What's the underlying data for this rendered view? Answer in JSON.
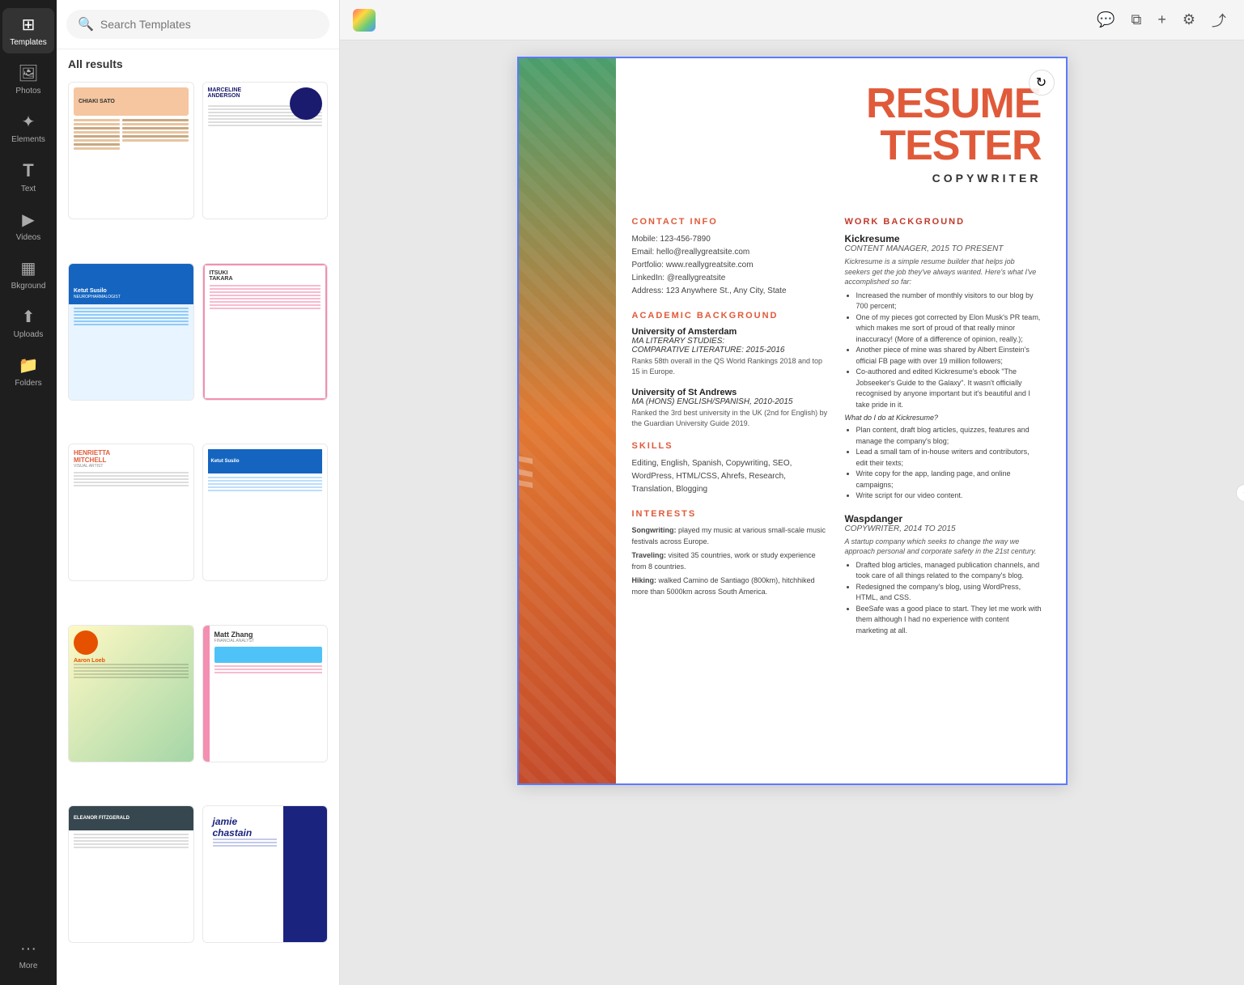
{
  "sidebar": {
    "title": "Templates",
    "items": [
      {
        "id": "templates",
        "label": "Templates",
        "icon": "⊞",
        "active": true
      },
      {
        "id": "photos",
        "label": "Photos",
        "icon": "🖼"
      },
      {
        "id": "elements",
        "label": "Elements",
        "icon": "✦"
      },
      {
        "id": "text",
        "label": "Text",
        "icon": "T"
      },
      {
        "id": "videos",
        "label": "Videos",
        "icon": "▶"
      },
      {
        "id": "background",
        "label": "Bkground",
        "icon": "▦"
      },
      {
        "id": "uploads",
        "label": "Uploads",
        "icon": "↑"
      },
      {
        "id": "folders",
        "label": "Folders",
        "icon": "🗁"
      },
      {
        "id": "more",
        "label": "More",
        "icon": "···"
      }
    ]
  },
  "search": {
    "placeholder": "Search Templates",
    "value": ""
  },
  "results": {
    "header": "All results"
  },
  "templates": [
    {
      "id": "chiaki",
      "name": "Chiaki Sato",
      "type": "chiaki"
    },
    {
      "id": "marceline",
      "name": "Marceline Anderson",
      "type": "marceline"
    },
    {
      "id": "ketut",
      "name": "Ketut Susilo",
      "type": "ketut-blue"
    },
    {
      "id": "itsuki",
      "name": "Itsuki Takara",
      "type": "pink-border"
    },
    {
      "id": "henrietta",
      "name": "Henrietta Mitchell",
      "type": "henrietta"
    },
    {
      "id": "ketut2",
      "name": "Ketut Susilo",
      "type": "ketut2"
    },
    {
      "id": "aaron",
      "name": "Aaron Loeb",
      "type": "aaron"
    },
    {
      "id": "matt",
      "name": "Matt Zhang",
      "type": "matt"
    },
    {
      "id": "eleanor",
      "name": "Eleanor Fitzgerald",
      "type": "eleanor"
    },
    {
      "id": "jamie",
      "name": "jamie chastain",
      "type": "jamie"
    }
  ],
  "toolbar": {
    "comment_label": "💬",
    "copy_label": "⧉",
    "add_label": "+",
    "settings_label": "⚙",
    "share_label": "⤴"
  },
  "resume": {
    "name_line1": "RESUME",
    "name_line2": "TESTER",
    "title": "COPYWRITER",
    "watermark": "in",
    "contact": {
      "section_title": "CONTACT INFO",
      "mobile": "Mobile: 123-456-7890",
      "email": "Email: hello@reallygreatsite.com",
      "portfolio": "Portfolio: www.reallygreatsite.com",
      "linkedin": "LinkedIn: @reallygreatsite",
      "address": "Address: 123 Anywhere St., Any City, State"
    },
    "academic": {
      "section_title": "ACADEMIC BACKGROUND",
      "uni1": {
        "name": "University of Amsterdam",
        "degree": "MA LITERARY STUDIES:",
        "field": "COMPARATIVE LITERATURE: 2015-2016",
        "desc": "Ranks 58th overall in the QS World Rankings 2018 and top 15 in Europe."
      },
      "uni2": {
        "name": "University of St Andrews",
        "degree": "MA (HONS) ENGLISH/SPANISH, 2010-2015",
        "desc": "Ranked the 3rd best university in the UK (2nd for English) by the Guardian University Guide 2019."
      }
    },
    "skills": {
      "section_title": "SKILLS",
      "content": "Editing, English, Spanish, Copywriting, SEO, WordPress, HTML/CSS, Ahrefs, Research, Translation, Blogging"
    },
    "interests": {
      "section_title": "INTERESTS",
      "items": [
        {
          "label": "Songwriting:",
          "text": "played my music at various small-scale music festivals across Europe."
        },
        {
          "label": "Traveling:",
          "text": "visited 35 countries, work or study experience from 8 countries."
        },
        {
          "label": "Hiking:",
          "text": "walked Camino de Santiago (800km), hitchhiked more than 5000km across South America."
        }
      ]
    },
    "work": {
      "section_title": "WORK BACKGROUND",
      "jobs": [
        {
          "company": "Kickresume",
          "role": "CONTENT MANAGER, 2015 TO PRESENT",
          "intro": "Kickresume is a simple resume builder that helps job seekers get the job they've always wanted. Here's what I've accomplished so far:",
          "bullets": [
            "Increased the number of monthly visitors to our blog by 700 percent;",
            "One of my pieces got corrected by Elon Musk's PR team, which makes me sort of proud of that really minor inaccuracy! (More of a difference of opinion, really.);",
            "Another piece of mine was shared by Albert Einstein's official FB page with over 19 million followers;",
            "Co-authored and edited Kickresume's ebook \"The Jobseeker's Guide to the Galaxy\". It wasn't officially recognised by anyone important but it's beautiful and I take pride in it."
          ],
          "question": "What do I do at Kickresume?",
          "sub_bullets": [
            "Plan content, draft blog articles, quizzes, features and manage the company's blog;",
            "Lead a small tam of in-house writers and contributors, edit their texts;",
            "Write copy for the app, landing page, and online campaigns;",
            "Write script for our video content."
          ]
        },
        {
          "company": "Waspdanger",
          "role": "COPYWRITER, 2014 TO 2015",
          "intro": "A startup company which seeks to change the way we approach personal and corporate safety in the 21st century.",
          "bullets": [
            "Drafted blog articles, managed publication channels, and took care of all things related to the company's blog.",
            "Redesigned the company's blog, using WordPress, HTML, and CSS.",
            "BeeSafe was a good place to start. They let me work with them although I had no experience with content marketing at all."
          ]
        }
      ]
    }
  }
}
